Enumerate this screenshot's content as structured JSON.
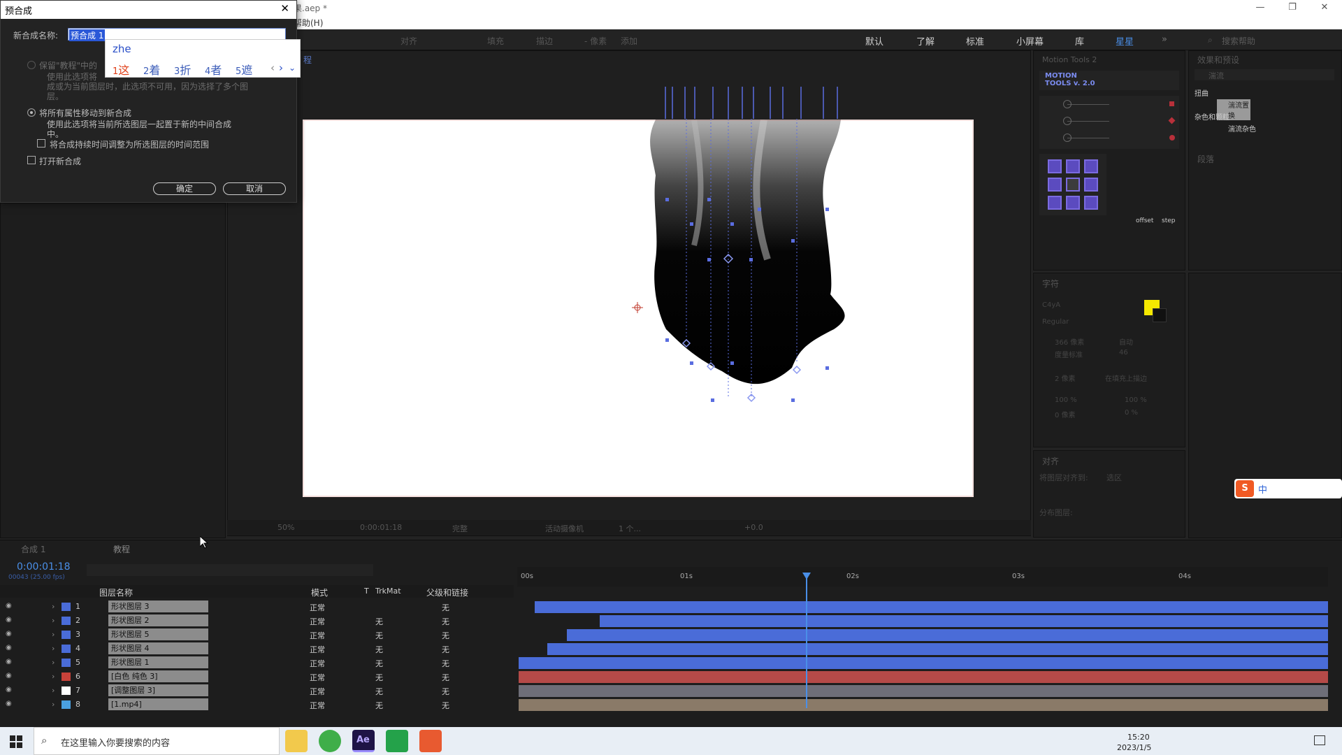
{
  "window": {
    "title_suffix": "果.aep *",
    "menu_suffix": "帮助(H)",
    "controls": [
      "—",
      "❐",
      "✕"
    ]
  },
  "toolbar": {
    "items": [
      "对齐",
      "填充",
      "描边",
      "- 像素",
      "添加"
    ],
    "workspaces": [
      "默认",
      "了解",
      "标准",
      "小屏幕",
      "库",
      "星星"
    ],
    "search_help": "搜索帮助"
  },
  "dialog": {
    "title": "预合成",
    "name_label": "新合成名称:",
    "name_value": "预合成 1",
    "option1_label": "保留\"教程\"中的",
    "option1_desc1": "使用此选项将",
    "option1_desc2": "成或为当前图层时，此选项不可用，因为选择了多个图",
    "option1_desc3": "层。",
    "option2_label": "将所有属性移动到新合成",
    "option2_desc1": "使用此选项将当前所选图层一起置于新的中间合成",
    "option2_desc2": "中。",
    "check1_label": "将合成持续时间调整为所选图层的时间范围",
    "check2_label": "打开新合成",
    "ok_label": "确定",
    "cancel_label": "取消"
  },
  "ime": {
    "input": "zhe",
    "candidates": [
      {
        "num": "1",
        "text": "这"
      },
      {
        "num": "2",
        "text": "着"
      },
      {
        "num": "3",
        "text": "折"
      },
      {
        "num": "4",
        "text": "者"
      },
      {
        "num": "5",
        "text": "遮"
      }
    ]
  },
  "viewer": {
    "tab": "程",
    "zoom": "50%",
    "timecode": "0:00:01:18",
    "quality": "完整",
    "camera": "活动摄像机",
    "views": "1 个...",
    "exposure": "+0.0"
  },
  "motion_tools": {
    "panel_title": "Motion Tools 2",
    "logo1": "MOTION",
    "logo2": "TOOLS v. 2.0",
    "offset_label": "offset",
    "step_label": "step"
  },
  "effects": {
    "panel_title": "效果和预设",
    "search": "湍流",
    "group1": "扭曲",
    "item1": "湍流置换",
    "group2": "杂色和颗粒",
    "item2": "湍流杂色",
    "paragraph_title": "段落"
  },
  "character": {
    "panel_title": "字符",
    "font": "C4yA",
    "style": "Regular",
    "size": "366 像素",
    "leading": "自动",
    "kerning": "度量标准",
    "tracking": "46",
    "stroke": "2 像素",
    "stroke_mode": "在填充上描边",
    "vscale": "100 %",
    "hscale": "100 %",
    "baseline": "0 像素",
    "tsume": "0 %",
    "fill_color": "#f5e800",
    "stroke_color": "#111111"
  },
  "align": {
    "panel_title": "对齐",
    "align_to_label": "将图层对齐到:",
    "align_to_value": "选区",
    "distribute_label": "分布图层:"
  },
  "timeline": {
    "tabs": [
      "合成 1",
      "教程"
    ],
    "timecode": "0:00:01:18",
    "frame_info": "00043 (25.00 fps)",
    "col_name": "图层名称",
    "col_mode": "模式",
    "col_t": "T",
    "col_trkmat": "TrkMat",
    "col_parent": "父级和链接",
    "ruler": [
      "00s",
      "01s",
      "02s",
      "03s",
      "04s"
    ],
    "layers": [
      {
        "num": "1",
        "name": "形状图层 3",
        "color": "#4a6cd8",
        "mode": "正常",
        "trkmat": "",
        "parent": "无",
        "bar_color": "#4a6cd8",
        "start": 0.02,
        "end": 1.0
      },
      {
        "num": "2",
        "name": "形状图层 2",
        "color": "#4a6cd8",
        "mode": "正常",
        "trkmat": "无",
        "parent": "无",
        "bar_color": "#4a6cd8",
        "start": 0.1,
        "end": 1.0
      },
      {
        "num": "3",
        "name": "形状图层 5",
        "color": "#4a6cd8",
        "mode": "正常",
        "trkmat": "无",
        "parent": "无",
        "bar_color": "#4a6cd8",
        "start": 0.06,
        "end": 1.0
      },
      {
        "num": "4",
        "name": "形状图层 4",
        "color": "#4a6cd8",
        "mode": "正常",
        "trkmat": "无",
        "parent": "无",
        "bar_color": "#4a6cd8",
        "start": 0.035,
        "end": 1.0
      },
      {
        "num": "5",
        "name": "形状图层 1",
        "color": "#4a6cd8",
        "mode": "正常",
        "trkmat": "无",
        "parent": "无",
        "bar_color": "#4a6cd8",
        "start": 0.0,
        "end": 1.0
      },
      {
        "num": "6",
        "name": "[白色 纯色 3]",
        "color": "#c8423a",
        "mode": "正常",
        "trkmat": "无",
        "parent": "无",
        "bar_color": "#b54a48",
        "start": 0.0,
        "end": 1.0
      },
      {
        "num": "7",
        "name": "[调整图层 3]",
        "color": "#ffffff",
        "mode": "正常",
        "trkmat": "无",
        "parent": "无",
        "bar_color": "#6e6e78",
        "start": 0.0,
        "end": 1.0
      },
      {
        "num": "8",
        "name": "[1.mp4]",
        "color": "#4aa0e0",
        "mode": "正常",
        "trkmat": "无",
        "parent": "无",
        "bar_color": "#8a7a68",
        "start": 0.0,
        "end": 1.0
      }
    ]
  },
  "taskbar": {
    "search_placeholder": "在这里输入你要搜索的内容",
    "time": "15:20",
    "date": "2023/1/5"
  },
  "sogou": {
    "zh": "中"
  }
}
